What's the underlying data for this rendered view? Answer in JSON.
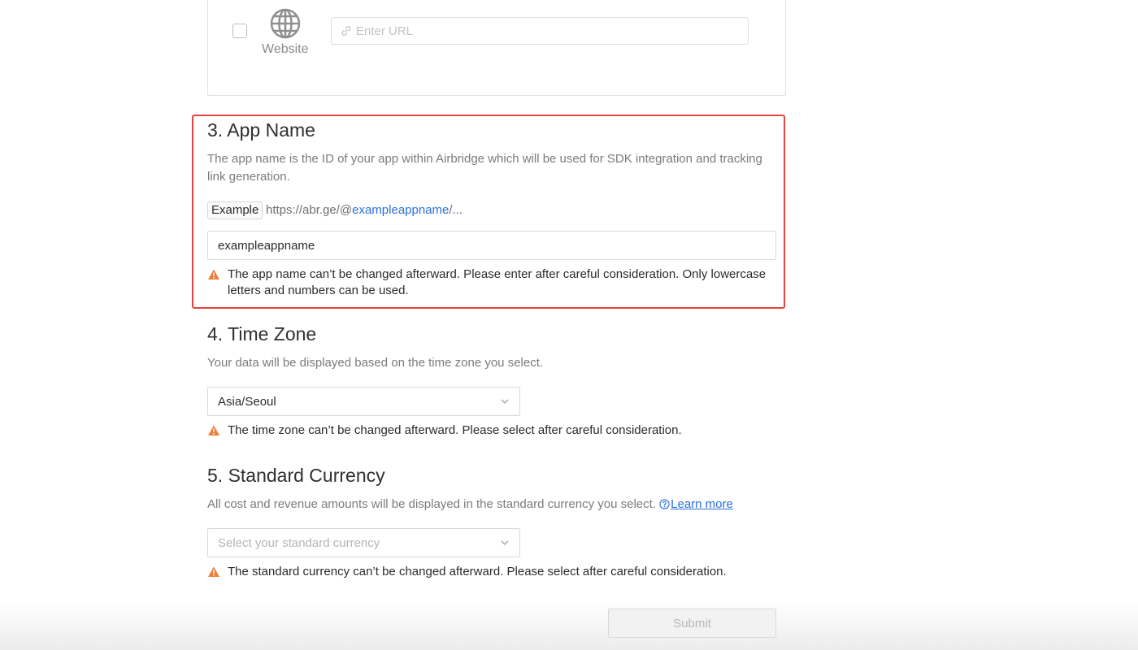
{
  "platform": {
    "website_label": "Website",
    "url_placeholder": "Enter URL"
  },
  "app_name": {
    "title": "3. App Name",
    "description": "The app name is the ID of your app within Airbridge which will be used for SDK integration and tracking link generation.",
    "example_badge": "Example",
    "example_prefix": "https://abr.ge/@",
    "example_highlight": "exampleappname",
    "example_suffix": "/...",
    "input_value": "exampleappname",
    "warning": "The app name can’t be changed afterward. Please enter after careful consideration. Only lowercase letters and numbers can be used."
  },
  "time_zone": {
    "title": "4. Time Zone",
    "description": "Your data will be displayed based on the time zone you select.",
    "selected": "Asia/Seoul",
    "warning": "The time zone can’t be changed afterward. Please select after careful consideration."
  },
  "currency": {
    "title": "5. Standard Currency",
    "description": "All cost and revenue amounts will be displayed in the standard currency you select.",
    "learn_more": "Learn more",
    "placeholder": "Select your standard currency",
    "warning": "The standard currency can’t be changed afterward. Please select after careful consideration."
  },
  "submit_label": "Submit",
  "colors": {
    "highlight_border": "#e2453f",
    "link": "#2b6fdc",
    "warning": "#ef7d38"
  },
  "icons": [
    "globe-icon",
    "link-icon",
    "warning-icon",
    "chevron-down-icon",
    "help-circle-icon"
  ]
}
